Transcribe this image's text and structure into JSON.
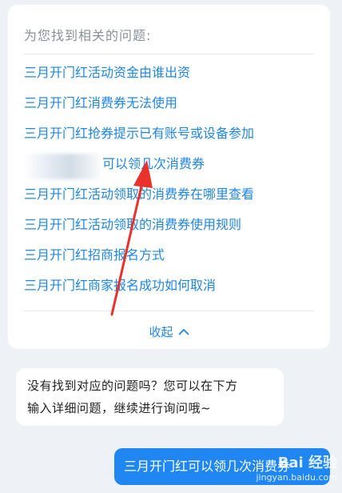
{
  "card": {
    "title": "为您找到相关的问题:",
    "questions": [
      "三月开门红活动资金由谁出资",
      "三月开门红消费券无法使用",
      "三月开门红抢券提示已有账号或设备参加",
      "可以领几次消费券",
      "三月开门红活动领取的消费券在哪里查看",
      "三月开门红活动领取的消费券使用规则",
      "三月开门红招商报名方式",
      "三月开门红商家报名成功如何取消"
    ],
    "collapse_label": "收起",
    "collapse_icon": "chevron-up-icon"
  },
  "bot_message": {
    "line1": "没有找到对应的问题吗？您可以在下方",
    "line2": "输入详细问题，继续进行询问哦~"
  },
  "user_message": "三月开门红可以领几次消费券",
  "watermark": {
    "brand": "Bai 经验",
    "url": "jingyan.baidu.com"
  },
  "colors": {
    "link": "#1f86e6",
    "arrow": "#e8322b",
    "user_bubble": "#1f86f2",
    "background": "#eef1f5"
  }
}
